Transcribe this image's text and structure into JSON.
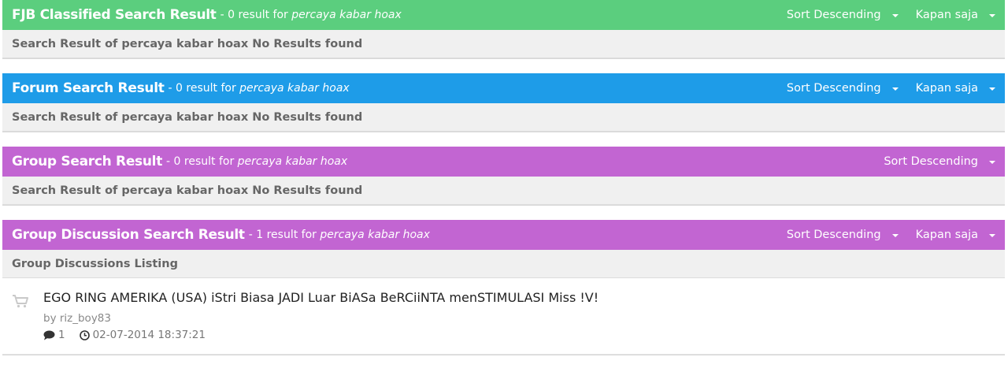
{
  "sections": [
    {
      "title": "FJB Classified Search Result",
      "meta_prefix": "- 0 result for",
      "query": "percaya kabar hoax",
      "sort_label": "Sort Descending",
      "time_label": "Kapan saja",
      "message": "Search Result of percaya kabar hoax No Results found"
    },
    {
      "title": "Forum Search Result",
      "meta_prefix": "- 0 result for",
      "query": "percaya kabar hoax",
      "sort_label": "Sort Descending",
      "time_label": "Kapan saja",
      "message": "Search Result of percaya kabar hoax No Results found"
    },
    {
      "title": "Group Search Result",
      "meta_prefix": "- 0 result for",
      "query": "percaya kabar hoax",
      "sort_label": "Sort Descending",
      "message": "Search Result of percaya kabar hoax No Results found"
    },
    {
      "title": "Group Discussion Search Result",
      "meta_prefix": "- 1 result for",
      "query": "percaya kabar hoax",
      "sort_label": "Sort Descending",
      "time_label": "Kapan saja",
      "message": "Group Discussions Listing",
      "items": [
        {
          "title": "EGO RING AMERIKA (USA) iStri Biasa JADI Luar BiASa BeRCiiNTA menSTIMULASI Miss !V!",
          "author": "by riz_boy83",
          "comments": "1",
          "datetime": "02-07-2014 18:37:21",
          "thumb_icon": "cart-icon"
        }
      ]
    }
  ],
  "colors": {
    "fjb": "#5bce7e",
    "forum": "#1e9ce8",
    "group": "#c265d2",
    "group_discussion": "#c265d2"
  }
}
